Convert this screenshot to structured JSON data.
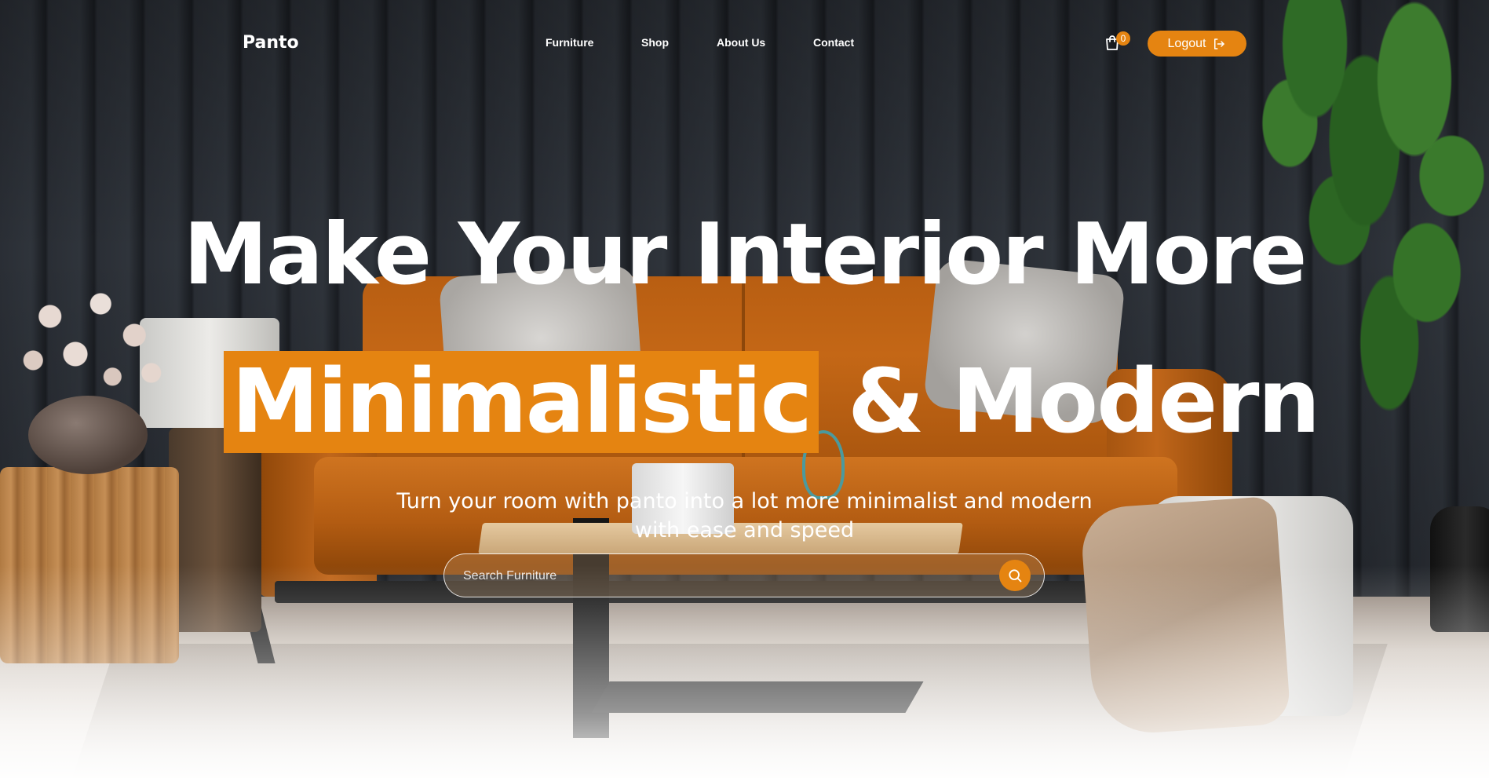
{
  "brand": {
    "logo": "Panto"
  },
  "nav": {
    "links": [
      {
        "label": "Furniture"
      },
      {
        "label": "Shop"
      },
      {
        "label": "About Us"
      },
      {
        "label": "Contact"
      }
    ]
  },
  "cart": {
    "count": "0",
    "icon": "shopping-bag-icon"
  },
  "logout": {
    "label": "Logout",
    "icon": "logout-icon"
  },
  "hero": {
    "line1": "Make Your Interior More",
    "highlight": "Minimalistic",
    "line2_rest": " & Modern",
    "subtitle_line1": "Turn your room with panto into a lot more minimalist and modern",
    "subtitle_line2": "with ease and speed"
  },
  "search": {
    "placeholder": "Search Furniture",
    "value": "",
    "icon": "search-icon"
  },
  "colors": {
    "accent": "#e58411",
    "text": "#ffffff",
    "wall": "#2a2e35"
  }
}
